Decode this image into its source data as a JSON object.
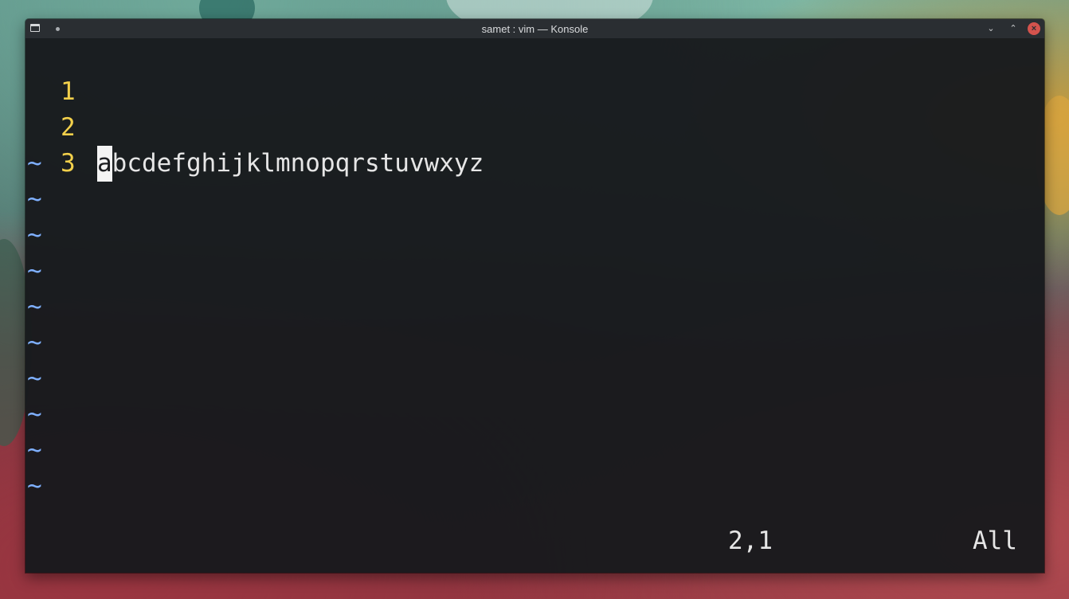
{
  "window": {
    "title": "samet : vim — Konsole",
    "minimize_glyph": "⌄",
    "maximize_glyph": "⌃",
    "close_glyph": "×"
  },
  "editor": {
    "lines": [
      {
        "number": "1",
        "text": ""
      },
      {
        "number": "2",
        "cursor_char": "a",
        "text": "bcdefghijklmnopqrstuvwxyz"
      },
      {
        "number": "3",
        "text": ""
      }
    ],
    "tilde": "~",
    "status": {
      "position": "2,1",
      "scroll": "All"
    }
  },
  "colors": {
    "line_number": "#f2d04b",
    "tilde": "#7fb0ff",
    "text": "#e6e6e6",
    "background": "#181a1d",
    "close_button": "#d4534d"
  }
}
